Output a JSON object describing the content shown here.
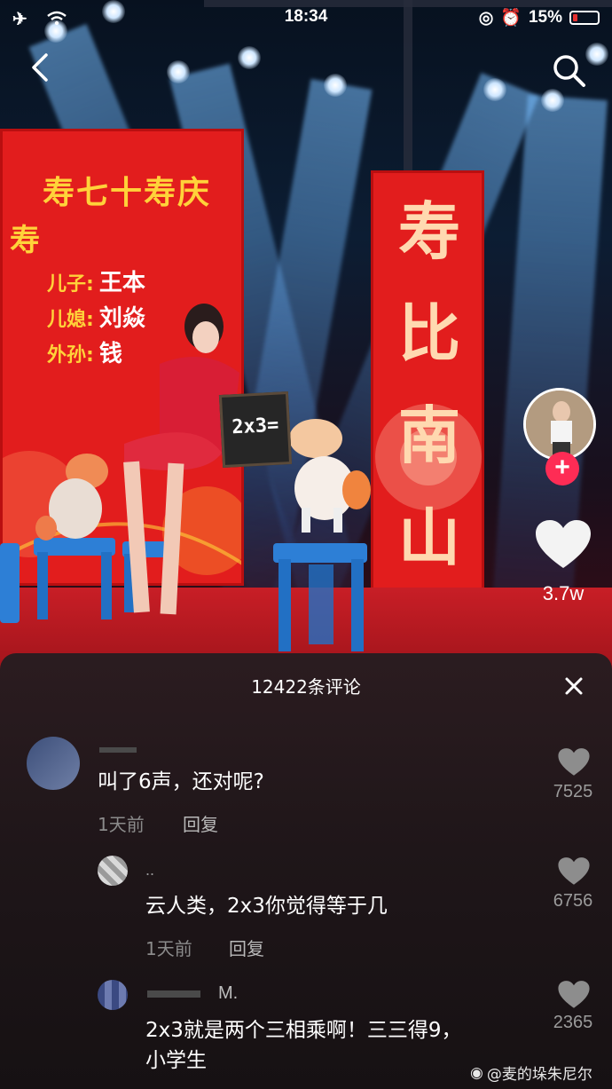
{
  "status_bar": {
    "time": "18:34",
    "battery": "15%",
    "battery_color": "#e53030"
  },
  "video": {
    "left_banner_title": "寿七十寿庆",
    "left_banner_sub": "寿",
    "left_banner_lines": [
      {
        "label": "儿子:",
        "name": "王本"
      },
      {
        "label": "儿媳:",
        "name": "刘焱"
      },
      {
        "label": "外孙:",
        "name": "钱"
      }
    ],
    "right_banner_chars": [
      "寿",
      "比",
      "南",
      "山"
    ],
    "blackboard_text": "2x3="
  },
  "rail": {
    "like_count": "3.7w",
    "follow_symbol": "+",
    "accent": "#fe2c55"
  },
  "comments_sheet": {
    "title": "12422条评论",
    "close_icon": "close-icon",
    "items": [
      {
        "user": "",
        "text": "叫了6声，还对呢?",
        "time": "1天前",
        "reply_label": "回复",
        "likes": "7525"
      },
      {
        "user": "..",
        "text": "云人类，2x3你觉得等于几",
        "time": "1天前",
        "reply_label": "回复",
        "likes": "6756"
      },
      {
        "user": "M.",
        "text_line1": "2x3就是两个三相乘啊！三三得9，",
        "text_line2": "小学生",
        "likes": "2365"
      }
    ]
  },
  "watermark": "@麦的垛朱尼尔"
}
